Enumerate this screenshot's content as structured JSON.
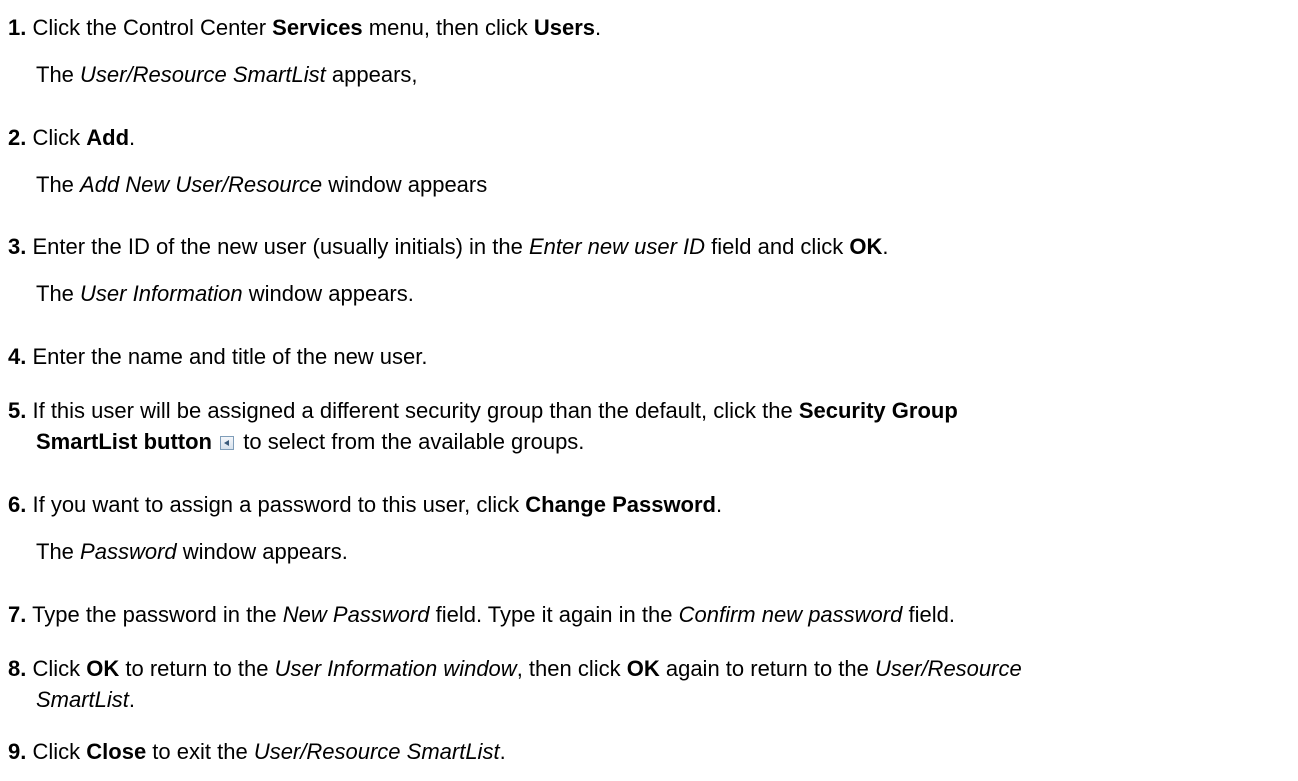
{
  "steps": [
    {
      "num": "1.",
      "parts": [
        "Click the Control Center ",
        "Services",
        " menu, then click ",
        "Users",
        "."
      ],
      "result": [
        "The ",
        "User/Resource SmartList",
        " appears,"
      ]
    },
    {
      "num": "2.",
      "parts": [
        "Click ",
        "Add",
        "."
      ],
      "result": [
        "The ",
        "Add New User/Resource",
        " window appears"
      ]
    },
    {
      "num": "3.",
      "parts": [
        "Enter the ID of the new user (usually initials) in the ",
        "Enter new user ID",
        " field and click ",
        "OK",
        "."
      ],
      "result": [
        "The ",
        "User Information",
        " window appears."
      ]
    },
    {
      "num": "4.",
      "parts": [
        "Enter the name and title of the new user."
      ]
    },
    {
      "num": "5.",
      "parts": [
        "If this user will be assigned a different security group than the default, click the ",
        "Security Group",
        "SmartList button",
        " to select from the available groups."
      ],
      "icon": "smartlist-button-icon"
    },
    {
      "num": "6.",
      "parts": [
        "If you want to assign a password to this user, click ",
        "Change Password",
        "."
      ],
      "result": [
        "The ",
        "Password",
        " window appears."
      ]
    },
    {
      "num": "7.",
      "parts": [
        "Type the password in the ",
        "New Password",
        " field. Type it again in the ",
        "Confirm new password",
        " field."
      ]
    },
    {
      "num": "8.",
      "parts": [
        "Click ",
        "OK",
        " to return to the ",
        "User Information window",
        ", then click ",
        "OK",
        " again to return to the ",
        "User/Resource",
        "SmartList",
        "."
      ]
    },
    {
      "num": "9.",
      "parts": [
        "Click ",
        "Close",
        " to exit the ",
        "User/Resource SmartList",
        "."
      ]
    }
  ]
}
